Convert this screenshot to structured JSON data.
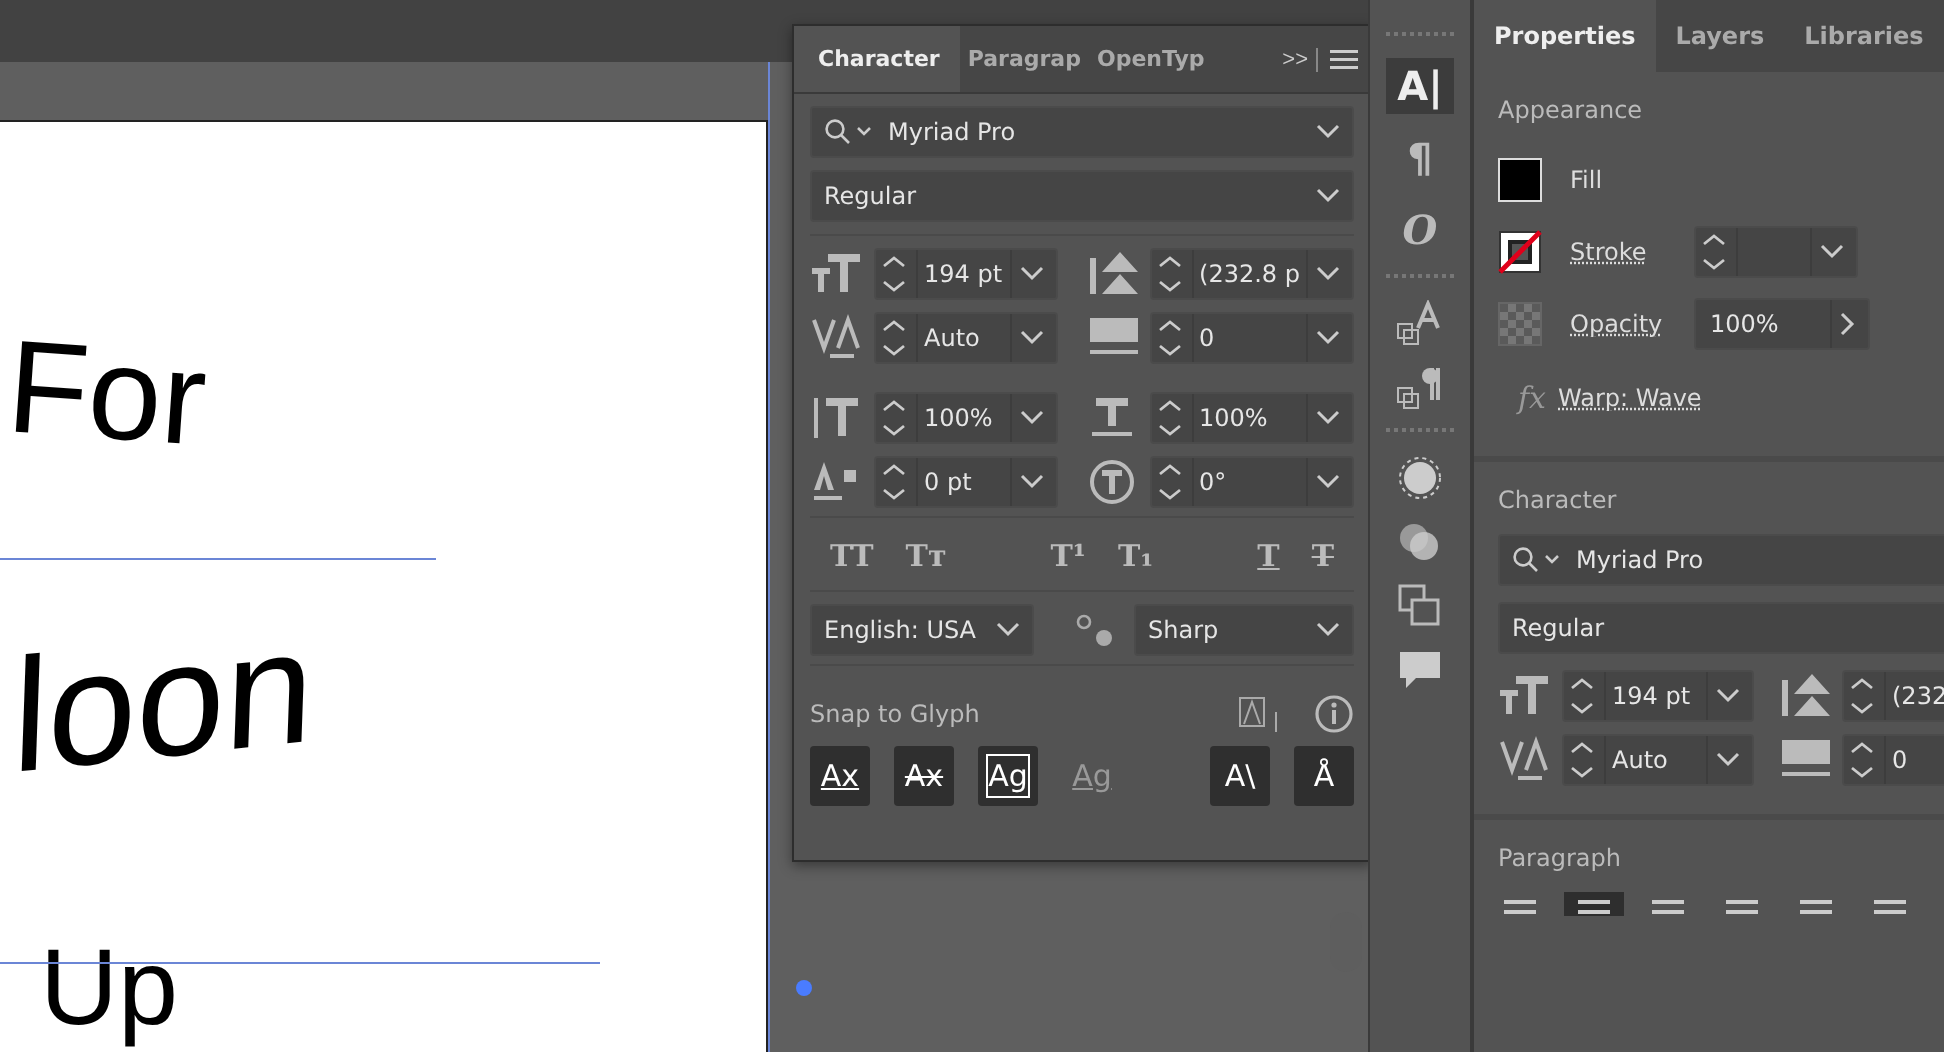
{
  "canvas": {
    "lines": [
      "For",
      "loon",
      "Up"
    ]
  },
  "character_panel": {
    "tabs": [
      {
        "label": "Character",
        "selected": true
      },
      {
        "label": "Paragrap",
        "selected": false
      },
      {
        "label": "OpenTyp",
        "selected": false
      }
    ],
    "overflow": ">>",
    "font_family": "Myriad Pro",
    "font_style": "Regular",
    "fields": [
      {
        "kind": "size",
        "value": "194 pt"
      },
      {
        "kind": "leading",
        "value": "(232.8 p"
      },
      {
        "kind": "kerning",
        "value": "Auto"
      },
      {
        "kind": "tracking",
        "value": "0"
      },
      {
        "kind": "vscale",
        "value": "100%"
      },
      {
        "kind": "hscale",
        "value": "100%"
      },
      {
        "kind": "baseline",
        "value": "0 pt"
      },
      {
        "kind": "rotation",
        "value": "0°"
      }
    ],
    "styles": [
      {
        "glyph": "TT",
        "kind": "plain"
      },
      {
        "glyph": "Tт",
        "kind": "plain"
      },
      {
        "glyph": "T¹",
        "kind": "plain"
      },
      {
        "glyph": "T₁",
        "kind": "plain"
      },
      {
        "glyph": "T",
        "kind": "underline"
      },
      {
        "glyph": "T",
        "kind": "strike"
      }
    ],
    "language": "English: USA",
    "antialias": "Sharp",
    "snap_label": "Snap to Glyph",
    "snap_buttons": [
      {
        "glyph": "Ax",
        "kind": "underline",
        "disabled": false
      },
      {
        "glyph": "Ax",
        "kind": "strike",
        "disabled": false
      },
      {
        "glyph": "Ag",
        "kind": "boxed",
        "disabled": false
      },
      {
        "glyph": "Ag",
        "kind": "underline",
        "disabled": true
      },
      {
        "glyph": "A\\",
        "kind": "plain",
        "disabled": false
      },
      {
        "glyph": "Å",
        "kind": "plain",
        "disabled": false
      }
    ]
  },
  "dock": [
    {
      "glyph": "A|",
      "selected": true
    },
    {
      "glyph": "¶",
      "selected": false
    },
    {
      "glyph": "O",
      "selected": false
    }
  ],
  "properties_panel": {
    "tabs": [
      {
        "label": "Properties",
        "selected": true
      },
      {
        "label": "Layers",
        "selected": false
      },
      {
        "label": "Libraries",
        "selected": false
      }
    ],
    "appearance": {
      "title": "Appearance",
      "fill": "Fill",
      "stroke": "Stroke",
      "opacity_label": "Opacity",
      "opacity": "100%",
      "fx": "fx",
      "effect": "Warp: Wave"
    },
    "character": {
      "title": "Character",
      "font_family": "Myriad Pro",
      "font_style": "Regular",
      "fields": [
        {
          "kind": "size",
          "value": "194 pt"
        },
        {
          "kind": "leading",
          "value": "(232"
        },
        {
          "kind": "kerning",
          "value": "Auto"
        },
        {
          "kind": "tracking",
          "value": "0"
        }
      ]
    },
    "paragraph": {
      "title": "Paragraph",
      "align": [
        {
          "selected": false
        },
        {
          "selected": true
        },
        {
          "selected": false
        },
        {
          "selected": false
        },
        {
          "selected": false
        },
        {
          "selected": false
        }
      ]
    }
  }
}
